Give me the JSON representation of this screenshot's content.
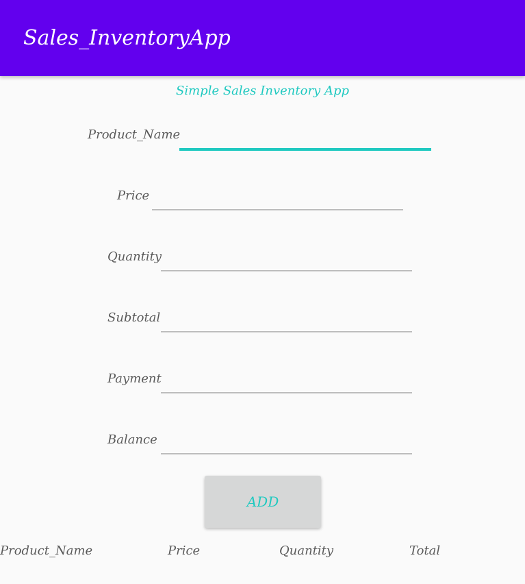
{
  "app_bar": {
    "title": "Sales_InventoryApp"
  },
  "subtitle": "Simple Sales Inventory App",
  "form": {
    "product_name_label": "Product_Name",
    "price_label": "Price",
    "quantity_label": "Quantity",
    "subtotal_label": "Subtotal",
    "payment_label": "Payment",
    "balance_label": "Balance",
    "product_name_value": "",
    "price_value": "",
    "quantity_value": "",
    "subtotal_value": "",
    "payment_value": "",
    "balance_value": ""
  },
  "add_button_label": "ADD",
  "table_headers": [
    "Product_Name",
    "Price",
    "Quantity",
    "Total"
  ],
  "colors": {
    "app_bar": "#6200ee",
    "accent": "#1fc9c0",
    "button_bg": "#d6d7d7"
  }
}
